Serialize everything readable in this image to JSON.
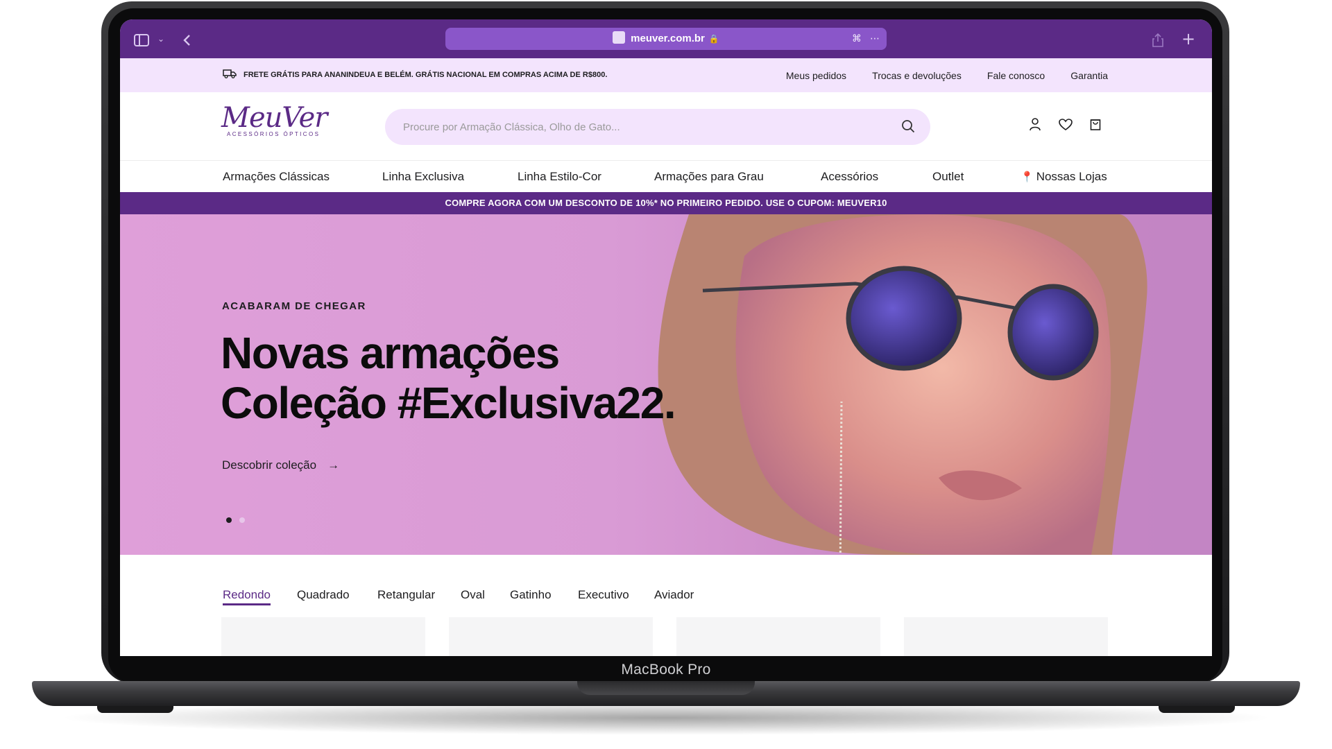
{
  "device": {
    "brand_label": "MacBook Pro"
  },
  "browser": {
    "url": "meuver.com.br",
    "icons": [
      "sidebar-icon",
      "chevron-down-icon",
      "back-icon",
      "lock-icon",
      "translate-icon",
      "more-icon",
      "share-icon",
      "new-tab-icon"
    ]
  },
  "topbar": {
    "shipping_text": "FRETE GRÁTIS PARA ANANINDEUA E BELÉM. GRÁTIS NACIONAL EM COMPRAS ACIMA DE R$800.",
    "links": [
      "Meus pedidos",
      "Trocas e devoluções",
      "Fale conosco",
      "Garantia"
    ]
  },
  "header": {
    "logo_main": "MeuVer",
    "logo_sub": "ACESSÓRIOS ÓPTICOS",
    "search_placeholder": "Procure por Armação Clássica, Olho de Gato..."
  },
  "nav": {
    "items": [
      "Armações Clássicas",
      "Linha Exclusiva",
      "Linha Estilo-Cor",
      "Armações para Grau",
      "Acessórios",
      "Outlet",
      "Nossas Lojas"
    ]
  },
  "promo": {
    "text": "COMPRE AGORA COM UM DESCONTO DE 10%* NO PRIMEIRO PEDIDO. USE O CUPOM: MEUVER10"
  },
  "hero": {
    "kicker": "ACABARAM DE CHEGAR",
    "title_line1": "Novas armações",
    "title_line2": "Coleção #Exclusiva22.",
    "cta": "Descobrir coleção",
    "slide_count": 2,
    "active_slide": 1
  },
  "categories": {
    "tabs": [
      "Redondo",
      "Quadrado",
      "Retangular",
      "Oval",
      "Gatinho",
      "Executivo",
      "Aviador"
    ],
    "active": "Redondo"
  },
  "colors": {
    "brand": "#5b2a86",
    "topbar_bg": "#f3e4fd",
    "hero_bg": "#d99bd5",
    "accent_url": "#8a56c9"
  }
}
